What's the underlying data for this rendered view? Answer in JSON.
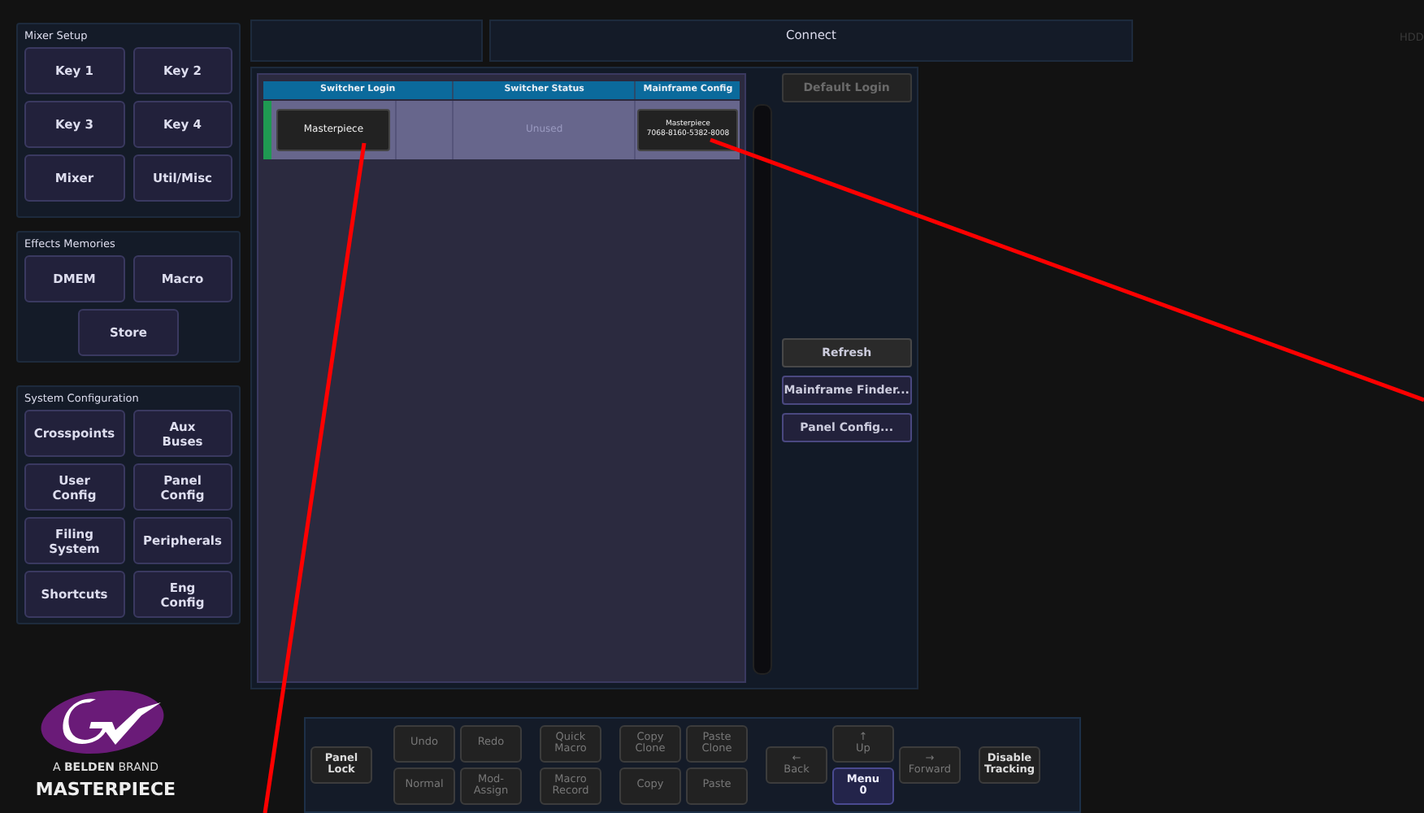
{
  "sidebar": {
    "groups": [
      {
        "title": "Mixer Setup",
        "buttons": [
          "Key 1",
          "Key 2",
          "Key 3",
          "Key 4",
          "Mixer",
          "Util/Misc"
        ]
      },
      {
        "title": "Effects Memories",
        "buttons": [
          "DMEM",
          "Macro",
          "Store"
        ]
      },
      {
        "title": "System Configuration",
        "buttons": [
          "Crosspoints",
          "Aux\nBuses",
          "User\nConfig",
          "Panel\nConfig",
          "Filing\nSystem",
          "Peripherals",
          "Shortcuts",
          "Eng\nConfig"
        ]
      }
    ]
  },
  "logo": {
    "tagline": "A **BELDEN** BRAND",
    "product": "MASTERPIECE"
  },
  "header": {
    "title": "Connect",
    "status": "HDD"
  },
  "table": {
    "columns": [
      "Switcher Login",
      "Switcher Status",
      "Mainframe Config"
    ],
    "rows": [
      {
        "color": "#1f9a52",
        "login": "Masterpiece",
        "status": "Unused",
        "config": "Masterpiece\n7068-8160-5382-8008"
      }
    ]
  },
  "actions": [
    {
      "label": "Default Login",
      "kind": "top",
      "disabled": true
    },
    {
      "label": "Refresh",
      "kind": "plain",
      "disabled": false
    },
    {
      "label": "Mainframe Finder...",
      "kind": "link",
      "disabled": false
    },
    {
      "label": "Panel Config...",
      "kind": "link",
      "disabled": false
    }
  ],
  "toolbar": [
    [
      {
        "label": "Panel\nLock",
        "disabled": false,
        "active": false
      }
    ],
    [
      {
        "label": "Undo",
        "disabled": true,
        "active": false
      },
      {
        "label": "Normal",
        "disabled": true,
        "active": false
      }
    ],
    [
      {
        "label": "Redo",
        "disabled": true,
        "active": false
      },
      {
        "label": "Mod-\nAssign",
        "disabled": true,
        "active": false
      }
    ],
    [
      {
        "label": "Quick\nMacro",
        "disabled": true,
        "active": false
      },
      {
        "label": "Macro\nRecord",
        "disabled": true,
        "active": false
      }
    ],
    [
      {
        "label": "Copy\nClone",
        "disabled": true,
        "active": false
      },
      {
        "label": "Copy",
        "disabled": true,
        "active": false
      }
    ],
    [
      {
        "label": "Paste\nClone",
        "disabled": true,
        "active": false
      },
      {
        "label": "Paste",
        "disabled": true,
        "active": false
      }
    ],
    [
      {
        "label": "←\nBack",
        "disabled": true,
        "active": false
      }
    ],
    [
      {
        "label": "↑\nUp",
        "disabled": true,
        "active": false
      },
      {
        "label": "Menu\n0",
        "disabled": false,
        "active": true
      }
    ],
    [
      {
        "label": "→\nForward",
        "disabled": true,
        "active": false
      }
    ],
    [
      {
        "label": "Disable\nTracking",
        "disabled": false,
        "active": false
      }
    ]
  ]
}
